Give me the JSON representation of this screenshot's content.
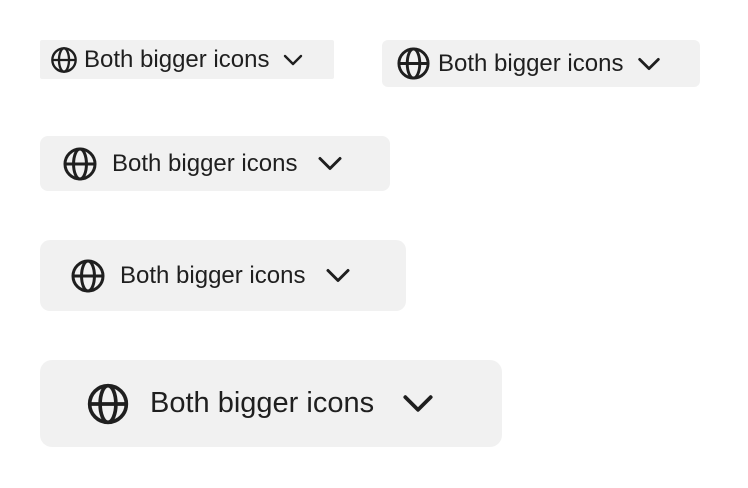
{
  "buttons": [
    {
      "label": "Both bigger icons",
      "icon": "globe-icon",
      "indicator": "chevron-down-icon"
    },
    {
      "label": "Both bigger icons",
      "icon": "globe-icon",
      "indicator": "chevron-down-icon"
    },
    {
      "label": "Both bigger icons",
      "icon": "globe-icon",
      "indicator": "chevron-down-icon"
    },
    {
      "label": "Both bigger icons",
      "icon": "globe-icon",
      "indicator": "chevron-down-icon"
    },
    {
      "label": "Both bigger icons",
      "icon": "globe-icon",
      "indicator": "chevron-down-icon"
    }
  ],
  "colors": {
    "button_background": "#f1f1f1",
    "text": "#1f1f1f"
  }
}
